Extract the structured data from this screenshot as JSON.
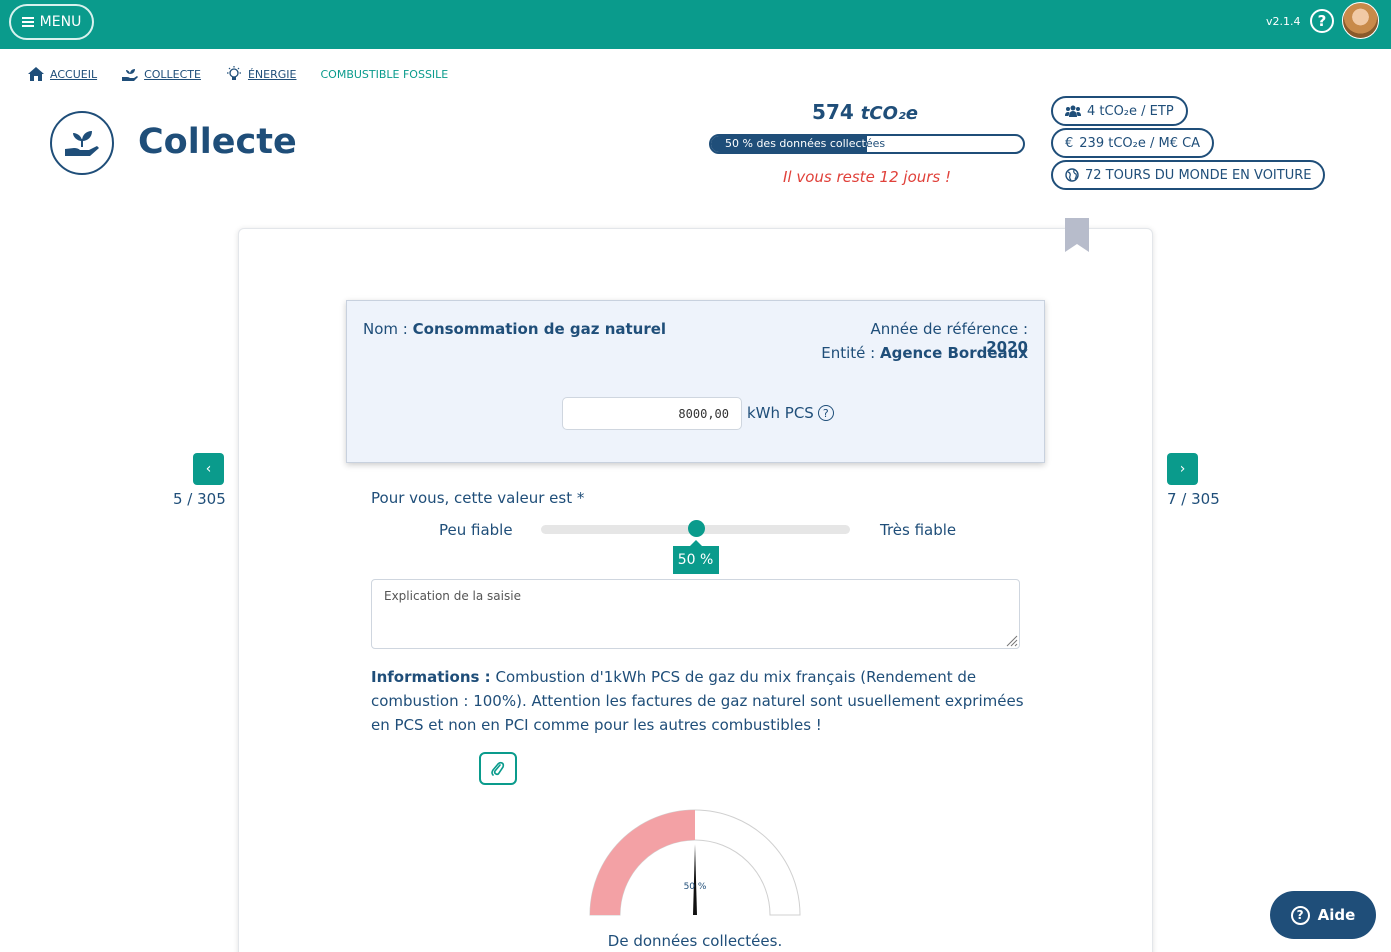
{
  "topbar": {
    "menu_label": "MENU",
    "version": "v2.1.4",
    "help_icon": "help-circle-icon"
  },
  "breadcrumb": [
    {
      "label": "ACCUEIL",
      "icon": "home-icon"
    },
    {
      "label": "COLLECTE",
      "icon": "plant-hand-icon"
    },
    {
      "label": "ÉNERGIE",
      "icon": "lightbulb-icon"
    },
    {
      "label": "COMBUSTIBLE FOSSILE"
    }
  ],
  "header": {
    "title": "Collecte",
    "co2_value": "574",
    "co2_unit": "tCO₂e",
    "progress_percent": 50,
    "progress_text": "50 % des données collectées",
    "deadline": "Il vous reste 12 jours !",
    "pills": [
      {
        "icon": "users-icon",
        "text": "4 tCO₂e / ETP"
      },
      {
        "icon": "euro-icon",
        "text": "239 tCO₂e / M€ CA"
      },
      {
        "icon": "globe-icon",
        "text": "72 TOURS DU MONDE EN VOITURE"
      }
    ]
  },
  "nav": {
    "prev_label": "‹",
    "next_label": "›",
    "prev_count": "5 / 305",
    "next_count": "7 / 305"
  },
  "entry": {
    "name_label": "Nom :",
    "name_value": "Consommation de gaz naturel",
    "year_label": "Année de référence :",
    "year_value": "2020",
    "entity_label": "Entité :",
    "entity_value": "Agence Bordeaux",
    "value": "8000,00",
    "unit": "kWh PCS",
    "unit_help": "?"
  },
  "reliability": {
    "question": "Pour vous, cette valeur est *",
    "low_label": "Peu fiable",
    "high_label": "Très fiable",
    "value_percent": 50,
    "value_label": "50 %"
  },
  "explanation": {
    "placeholder": "Explication de la saisie",
    "value": ""
  },
  "info": {
    "label": "Informations :",
    "text": "Combustion d'1kWh PCS de gaz du mix français (Rendement de combustion : 100%). Attention les factures de gaz naturel sont usuellement exprimées en PCS et non en PCI comme pour les autres combustibles !"
  },
  "gauge": {
    "percent": 50,
    "label": "50 %",
    "caption": "De données collectées.",
    "fill_color": "#f3a1a5"
  },
  "aide_label": "Aide",
  "colors": {
    "teal": "#0a9b8c",
    "navy": "#1f4e79",
    "alert": "#e0413a"
  }
}
